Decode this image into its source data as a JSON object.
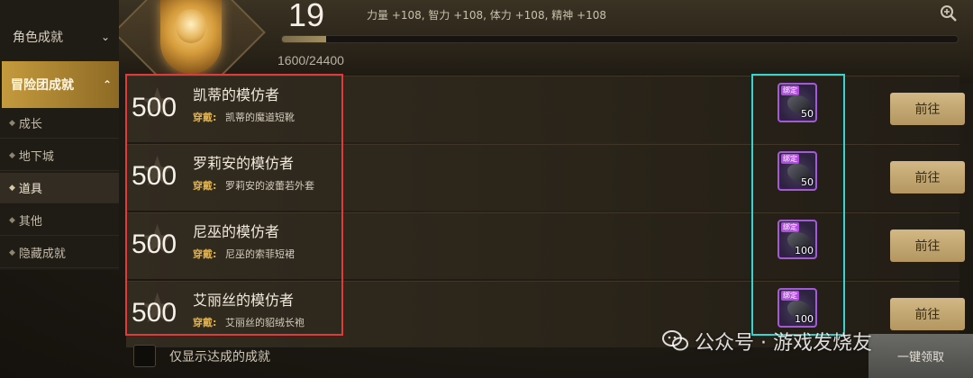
{
  "header": {
    "level": "19",
    "bonus": "力量 +108, 智力 +108, 体力 +108, 精神 +108",
    "progress_text": "1600/24400",
    "progress_fraction": 0.0656
  },
  "sidebar": {
    "categories": [
      {
        "label": "角色成就",
        "chevron": "⌄"
      },
      {
        "label": "冒险团成就",
        "chevron": "⌃"
      }
    ],
    "subitems": [
      {
        "label": "成长"
      },
      {
        "label": "地下城"
      },
      {
        "label": "道具"
      },
      {
        "label": "其他"
      },
      {
        "label": "隐藏成就"
      }
    ]
  },
  "achievements": [
    {
      "points": "500",
      "title": "凯蒂的模仿者",
      "req_label": "穿戴:",
      "req_value": "凯蒂的魔道短靴",
      "reward_tag": "绑定",
      "reward_qty": "50",
      "button": "前往"
    },
    {
      "points": "500",
      "title": "罗莉安的模仿者",
      "req_label": "穿戴:",
      "req_value": "罗莉安的波蕾若外套",
      "reward_tag": "绑定",
      "reward_qty": "50",
      "button": "前往"
    },
    {
      "points": "500",
      "title": "尼巫的模仿者",
      "req_label": "穿戴:",
      "req_value": "尼巫的索菲短裙",
      "reward_tag": "绑定",
      "reward_qty": "100",
      "button": "前往"
    },
    {
      "points": "500",
      "title": "艾丽丝的模仿者",
      "req_label": "穿戴:",
      "req_value": "艾丽丝的貂绒长袍",
      "reward_tag": "绑定",
      "reward_qty": "100",
      "button": "前往"
    }
  ],
  "footer": {
    "checkbox_label": "仅显示达成的成就",
    "claim_all": "一键领取"
  },
  "watermark": {
    "text": "公众号 · 游戏发烧友"
  },
  "colors": {
    "highlight_red": "#e23a3a",
    "highlight_cyan": "#33d6d0",
    "accent_gold": "#c59a3e"
  }
}
